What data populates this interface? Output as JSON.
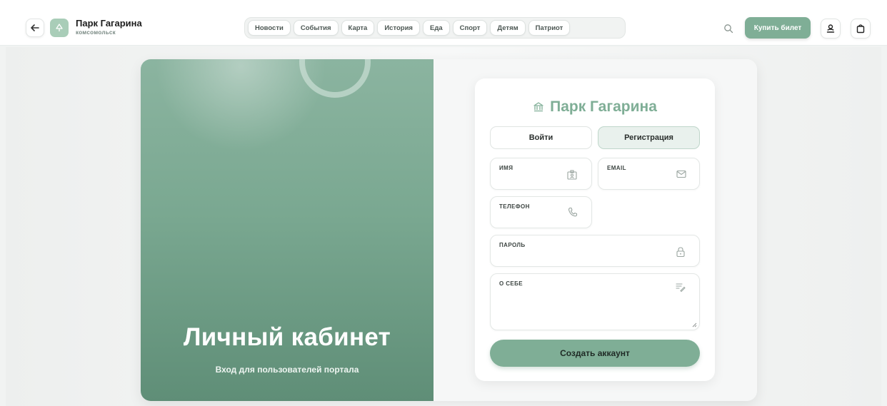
{
  "header": {
    "brand_title": "Парк Гагарина",
    "brand_subtitle": "комсомольск",
    "nav_items": [
      "Новости",
      "События",
      "Карта",
      "История",
      "Еда",
      "Спорт",
      "Детям",
      "Патриот"
    ],
    "buy_button": "Купить билет",
    "icons": {
      "back": "arrow-left-icon",
      "logo": "tree-icon",
      "search": "search-icon",
      "user": "user-icon",
      "cart": "shopping-bag-icon"
    }
  },
  "hero": {
    "title": "Личный кабинет",
    "subtitle": "Вход для пользователей портала"
  },
  "form": {
    "title": "Парк Гагарина",
    "title_icon": "museum-icon",
    "tabs": {
      "login": "Войти",
      "register": "Регистрация",
      "active": "register"
    },
    "fields": {
      "name": "ИМЯ",
      "email": "EMAIL",
      "phone": "ТЕЛЕФОН",
      "password": "ПАРОЛЬ",
      "about": "О СЕБЕ"
    },
    "submit": "Создать аккаунт"
  },
  "colors": {
    "accent": "#7fae96",
    "hero_top": "#8bb4a0",
    "hero_bottom": "#5f8e77"
  }
}
